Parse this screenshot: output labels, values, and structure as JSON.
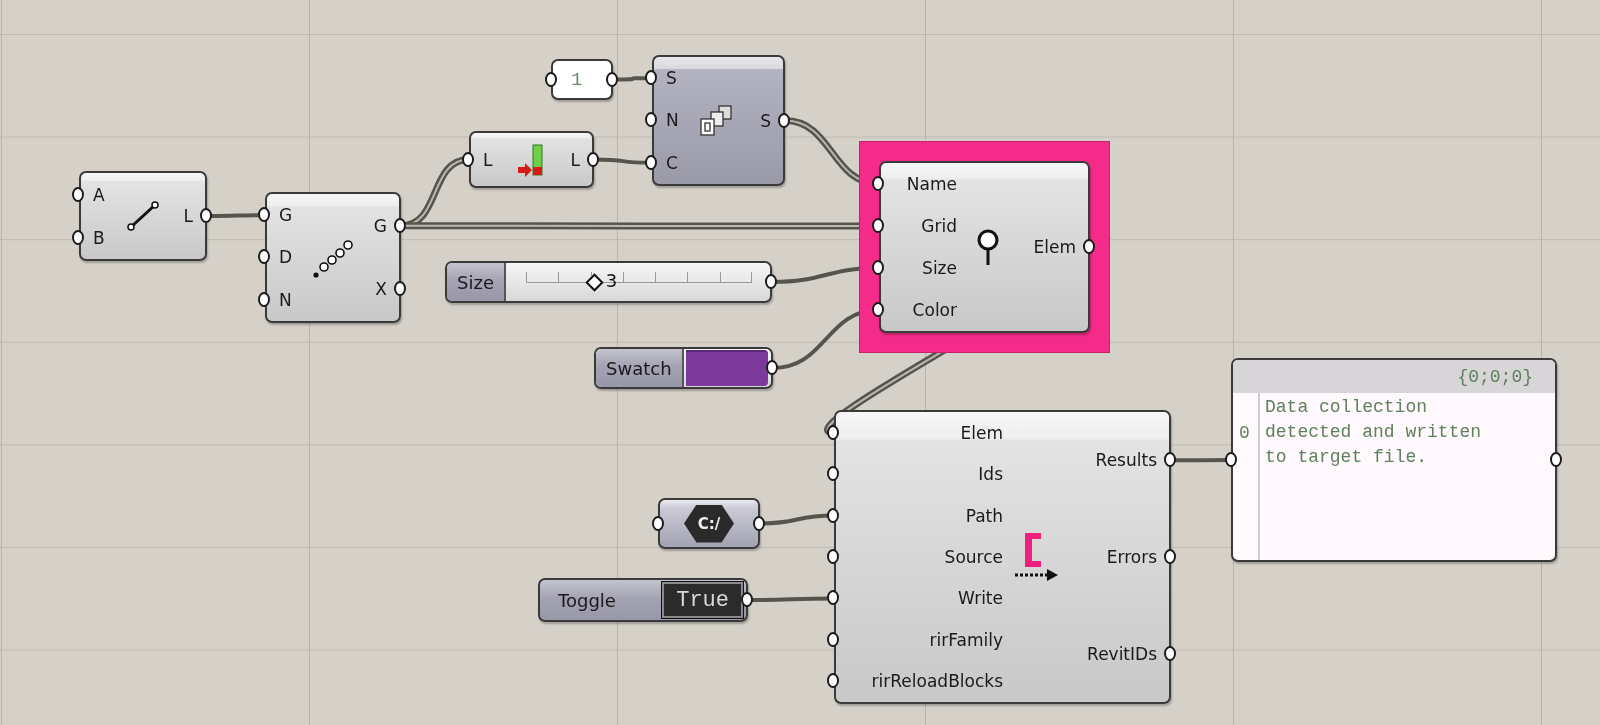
{
  "canvas": {
    "components": [
      {
        "kind": "component",
        "inputs": [
          "A",
          "B"
        ],
        "outputs": [
          "L"
        ],
        "preview": true,
        "grouped": false
      },
      {
        "kind": "component",
        "inputs": [
          "G",
          "D",
          "N"
        ],
        "outputs": [
          "G",
          "X"
        ],
        "preview": true,
        "grouped": false
      },
      {
        "kind": "number",
        "value": "1"
      },
      {
        "kind": "component",
        "inputs": [
          "L"
        ],
        "outputs": [
          "L"
        ],
        "preview": true,
        "grouped": false
      },
      {
        "kind": "component",
        "inputs": [
          "S",
          "N",
          "C"
        ],
        "outputs": [
          "S"
        ],
        "preview": false,
        "grouped": false
      },
      {
        "kind": "component",
        "inputs": [
          "Name",
          "Grid",
          "Size",
          "Color"
        ],
        "outputs": [
          "Elem"
        ],
        "preview": true,
        "grouped": true
      },
      {
        "kind": "slider",
        "label": "Size",
        "level": 0.3,
        "reading": "3"
      },
      {
        "kind": "swatch",
        "label": "Swatch",
        "color": "#7b3a9b"
      },
      {
        "kind": "path",
        "text": "C:/"
      },
      {
        "kind": "toggle",
        "label": "Toggle",
        "value": "True"
      },
      {
        "kind": "component",
        "inputs": [
          "Elem",
          "Ids",
          "Path",
          "Source",
          "Write",
          "rirFamily",
          "rirReloadBlocks"
        ],
        "outputs": [
          "Results",
          "Errors",
          "RevitIDs"
        ],
        "preview": true,
        "grouped": false
      },
      {
        "kind": "panel",
        "header": "{0;0;0}",
        "rows": [
          {
            "index": "0",
            "text": "Data collection detected and written to target file."
          }
        ]
      }
    ]
  }
}
